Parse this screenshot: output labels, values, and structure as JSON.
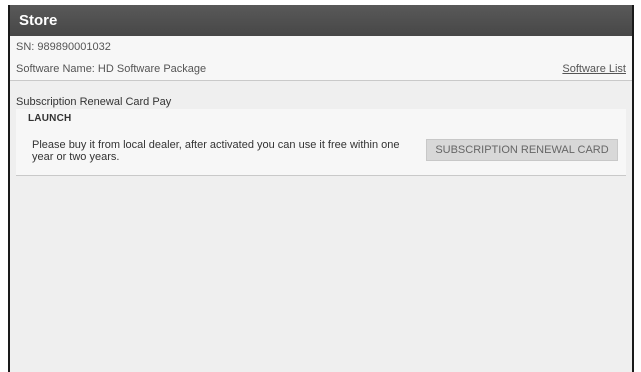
{
  "window": {
    "title": "Store"
  },
  "info": {
    "sn": "SN: 989890001032",
    "software_name": "Software Name: HD Software Package",
    "software_list_link": "Software List"
  },
  "subscription": {
    "section_title": "Subscription Renewal Card Pay",
    "brand": "LAUNCH",
    "description": "Please buy it from local dealer, after activated you can use it free within one year or two years.",
    "button_label": "SUBSCRIPTION RENEWAL CARD"
  }
}
